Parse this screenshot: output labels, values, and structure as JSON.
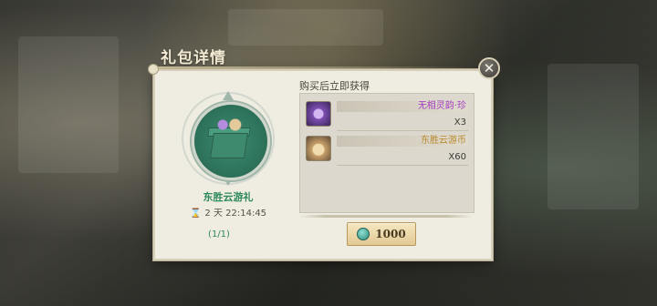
{
  "dialog": {
    "title": "礼包详情",
    "close_icon": "✕"
  },
  "pack": {
    "name": "东胜云游礼",
    "timer_icon": "hourglass-icon",
    "timer": "2 天 22:14:45",
    "limit": "(1/1)"
  },
  "rewards": {
    "header": "购买后立即获得",
    "items": [
      {
        "name": "无相灵韵·珍",
        "qty": "X3",
        "icon": "spirit-crystal-icon",
        "color": "#a23bc1"
      },
      {
        "name": "东胜云游币",
        "qty": "X60",
        "icon": "travel-coin-icon",
        "color": "#b7892e"
      }
    ]
  },
  "purchase": {
    "currency_icon": "jade-icon",
    "price": "1000"
  }
}
